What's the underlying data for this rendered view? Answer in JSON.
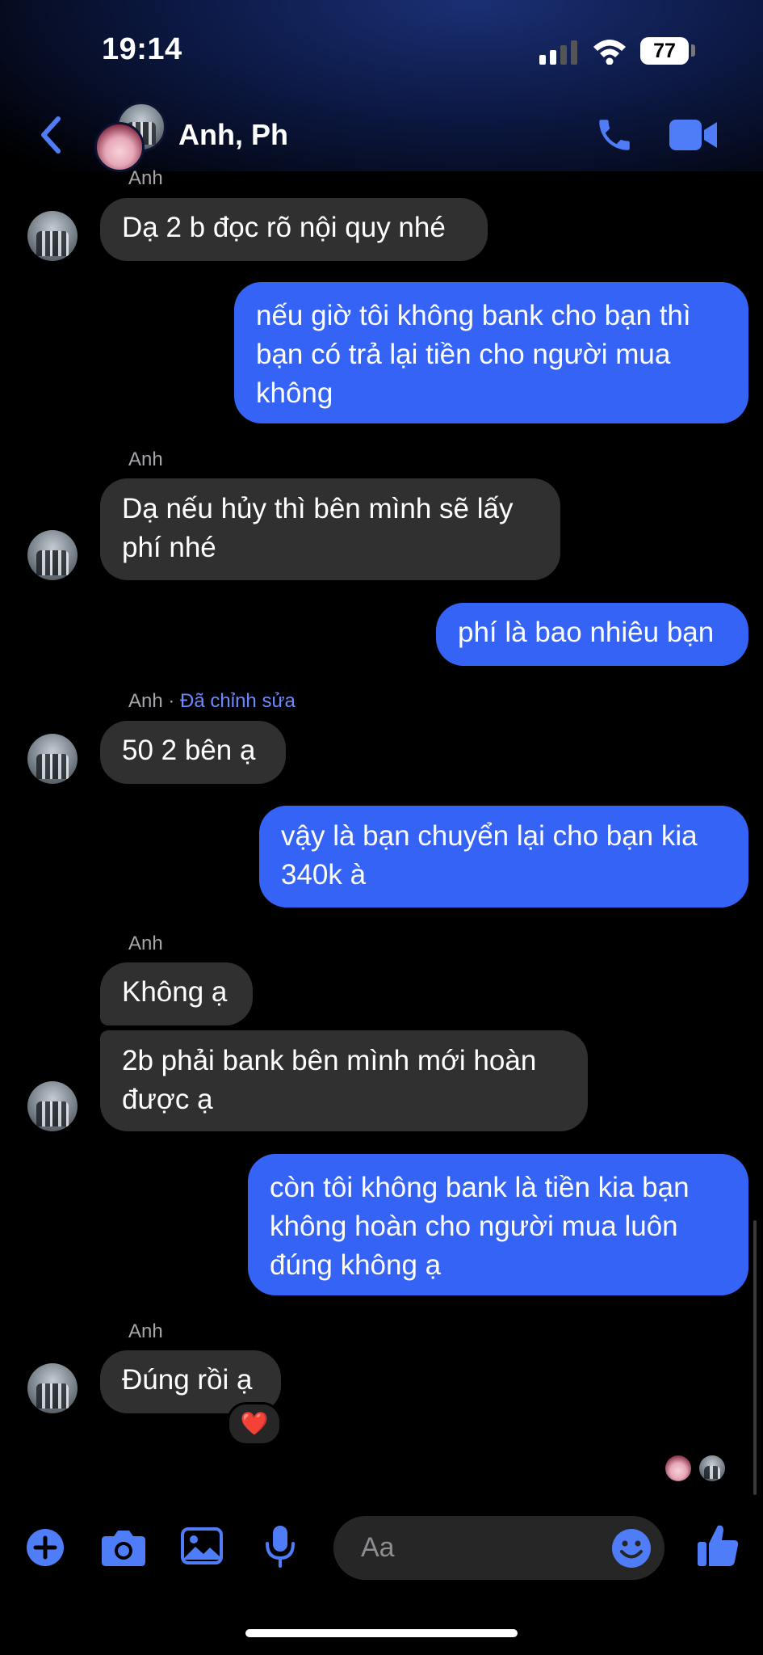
{
  "status": {
    "time": "19:14",
    "battery": "77"
  },
  "header": {
    "title": "Anh, Ph"
  },
  "messages": [
    {
      "sender": "Anh",
      "text": "Dạ 2 b đọc rõ nội quy nhé"
    },
    {
      "text": "nếu giờ tôi không bank cho bạn thì bạn có trả lại tiền cho người mua không"
    },
    {
      "sender": "Anh",
      "text": "Dạ nếu hủy thì bên mình sẽ lấy phí nhé"
    },
    {
      "text": "phí là bao nhiêu bạn"
    },
    {
      "sender": "Anh",
      "edited": "Đã chỉnh sửa",
      "text": "50 2 bên ạ"
    },
    {
      "text": "vậy là bạn chuyển lại cho bạn kia 340k à"
    },
    {
      "sender": "Anh",
      "text": "Không ạ"
    },
    {
      "text": "2b phải bank bên mình mới hoàn được ạ"
    },
    {
      "text": "còn tôi không bank là tiền kia bạn không hoàn cho người mua luôn đúng không ạ"
    },
    {
      "sender": "Anh",
      "text": "Đúng rồi ạ",
      "reaction": "❤️"
    }
  ],
  "composer": {
    "placeholder": "Aa"
  },
  "icons": {
    "back": "chevron-left-icon",
    "call": "phone-icon",
    "video": "video-icon",
    "add": "plus-icon",
    "camera": "camera-icon",
    "gallery": "image-icon",
    "mic": "microphone-icon",
    "emoji": "emoji-icon",
    "like": "thumbs-up-icon"
  },
  "colors": {
    "accent": "#3563f5",
    "incoming": "#303030",
    "icon": "#4f7cf7"
  }
}
